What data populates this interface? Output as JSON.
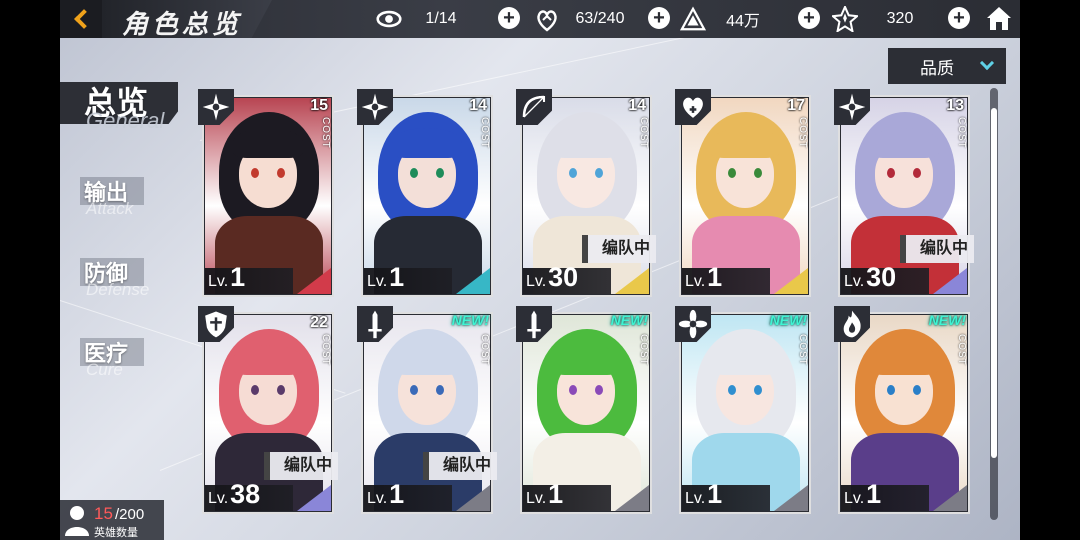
{
  "header": {
    "title": "角色总览",
    "resources": [
      {
        "icon": "eye-icon",
        "value": "1/14"
      },
      {
        "icon": "stamina-icon",
        "value": "63/240"
      },
      {
        "icon": "gold-icon",
        "value": "44万"
      },
      {
        "icon": "crystal-icon",
        "value": "320"
      }
    ]
  },
  "sidebar": {
    "tabs": [
      {
        "id": "general",
        "cn": "总览",
        "en": "General",
        "active": true
      },
      {
        "id": "attack",
        "cn": "输出",
        "en": "Attack",
        "active": false
      },
      {
        "id": "defense",
        "cn": "防御",
        "en": "Defense",
        "active": false
      },
      {
        "id": "cure",
        "cn": "医疗",
        "en": "Cure",
        "active": false
      }
    ]
  },
  "sort": {
    "label": "品质"
  },
  "hero_count": {
    "current": "15",
    "max": "/200",
    "label": "英雄数量"
  },
  "cards": [
    {
      "cost": "15",
      "cost_label": "COST",
      "lv_prefix": "Lv.",
      "level": "1",
      "class_icon": "shuriken-icon",
      "in_team": false,
      "is_new": false,
      "accent": "#d23b4a",
      "hair": "#1c1a22",
      "skin": "#f6ddd2",
      "eyes": "#c23a2e",
      "outfit": "#5a2a22",
      "bg": "#b84552"
    },
    {
      "cost": "14",
      "cost_label": "COST",
      "lv_prefix": "Lv.",
      "level": "1",
      "class_icon": "shuriken-icon",
      "in_team": false,
      "is_new": false,
      "accent": "#37b7c6",
      "hair": "#2a4fc4",
      "skin": "#f3dfd8",
      "eyes": "#1e8c5a",
      "outfit": "#262a34",
      "bg": "#c9d8e8"
    },
    {
      "cost": "14",
      "cost_label": "COST",
      "lv_prefix": "Lv.",
      "level": "30",
      "class_icon": "bow-icon",
      "in_team": true,
      "team_label": "编队中",
      "is_new": false,
      "accent": "#e9c84a",
      "hair": "#dedfe8",
      "skin": "#f8e8e2",
      "eyes": "#4fa4d8",
      "outfit": "#efe6d8",
      "bg": "#d9dce8"
    },
    {
      "cost": "17",
      "cost_label": "COST",
      "lv_prefix": "Lv.",
      "level": "1",
      "class_icon": "heart-icon",
      "in_team": false,
      "is_new": false,
      "accent": "#e9c84a",
      "hair": "#e8b95a",
      "skin": "#f8e3d8",
      "eyes": "#3a8a3a",
      "outfit": "#e68bb0",
      "bg": "#f1d7c0"
    },
    {
      "cost": "13",
      "cost_label": "COST",
      "lv_prefix": "Lv.",
      "level": "30",
      "class_icon": "shuriken-icon",
      "in_team": true,
      "team_label": "编队中",
      "is_new": false,
      "accent": "#8a86d8",
      "hair": "#a9a8d8",
      "skin": "#f7e1da",
      "eyes": "#b32a3a",
      "outfit": "#c33038",
      "bg": "#d6d3e6"
    },
    {
      "cost": "22",
      "cost_label": "COST",
      "lv_prefix": "Lv.",
      "level": "38",
      "class_icon": "shield-icon",
      "in_team": true,
      "team_label": "编队中",
      "is_new": false,
      "accent": "#8a86d8",
      "hair": "#e0606f",
      "skin": "#f6dcd4",
      "eyes": "#5a3a6a",
      "outfit": "#2e2838",
      "bg": "#e2e0ea"
    },
    {
      "cost": "",
      "cost_label": "COST",
      "lv_prefix": "Lv.",
      "level": "1",
      "class_icon": "sword-icon",
      "in_team": true,
      "team_label": "编队中",
      "is_new": true,
      "new_label": "NEW!",
      "accent": "#7c7c86",
      "hair": "#cfd8ea",
      "skin": "#f6e2da",
      "eyes": "#3a6ab8",
      "outfit": "#2b3c68",
      "bg": "#e8e6ee"
    },
    {
      "cost": "",
      "cost_label": "COST",
      "lv_prefix": "Lv.",
      "level": "1",
      "class_icon": "sword-icon",
      "in_team": false,
      "is_new": true,
      "new_label": "NEW!",
      "accent": "#7c7c86",
      "hair": "#4cbb3e",
      "skin": "#f8e4da",
      "eyes": "#8a4ab8",
      "outfit": "#f3efe6",
      "bg": "#dfe6d8"
    },
    {
      "cost": "",
      "cost_label": "COST",
      "lv_prefix": "Lv.",
      "level": "1",
      "class_icon": "flower-icon",
      "in_team": false,
      "is_new": true,
      "new_label": "NEW!",
      "accent": "#7c7c86",
      "hair": "#e6e8ee",
      "skin": "#f7e6e0",
      "eyes": "#2f8fd0",
      "outfit": "#9fd8ec",
      "bg": "#bfe6f3"
    },
    {
      "cost": "",
      "cost_label": "COST",
      "lv_prefix": "Lv.",
      "level": "1",
      "class_icon": "flame-icon",
      "in_team": false,
      "is_new": true,
      "new_label": "NEW!",
      "accent": "#7c7c86",
      "hair": "#e0883a",
      "skin": "#f8e1d2",
      "eyes": "#2a7fc8",
      "outfit": "#5a3e8a",
      "bg": "#e9d8c6"
    }
  ]
}
